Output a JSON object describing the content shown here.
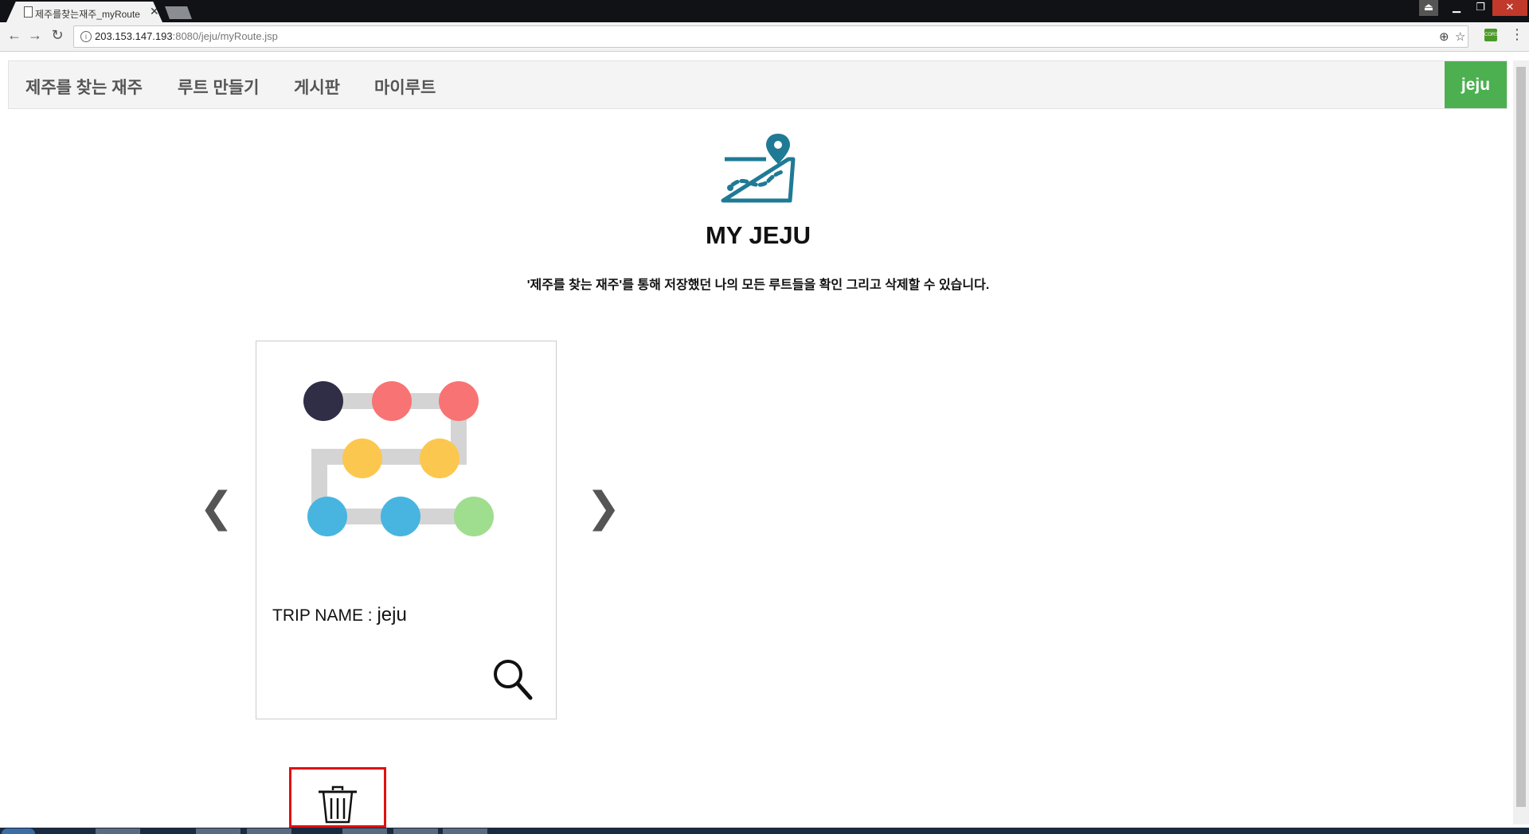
{
  "browser": {
    "tab_title": "제주를찾는재주_myRoute",
    "url_host": "203.153.147.193",
    "url_path": ":8080/jeju/myRoute.jsp"
  },
  "nav": {
    "brand": "제주를 찾는 재주",
    "items": [
      "루트 만들기",
      "게시판",
      "마이루트"
    ],
    "user": "jeju"
  },
  "header": {
    "icon": "map-route-icon",
    "title": "MY JEJU",
    "subtitle": "'제주를 찾는 재주'를 통해 저장했던 나의 모든 루트들을 확인 그리고 삭제할 수 있습니다."
  },
  "card": {
    "image_icon": "route-dots-icon",
    "trip_label": "TRIP NAME : ",
    "trip_name": "jeju",
    "search_icon": "magnifier-icon"
  },
  "carousel": {
    "prev": "❮",
    "next": "❯"
  },
  "actions": {
    "delete_icon": "trash-icon"
  },
  "colors": {
    "accent": "#4cb050",
    "icon_teal": "#1f7a95",
    "highlight": "#e01010"
  }
}
